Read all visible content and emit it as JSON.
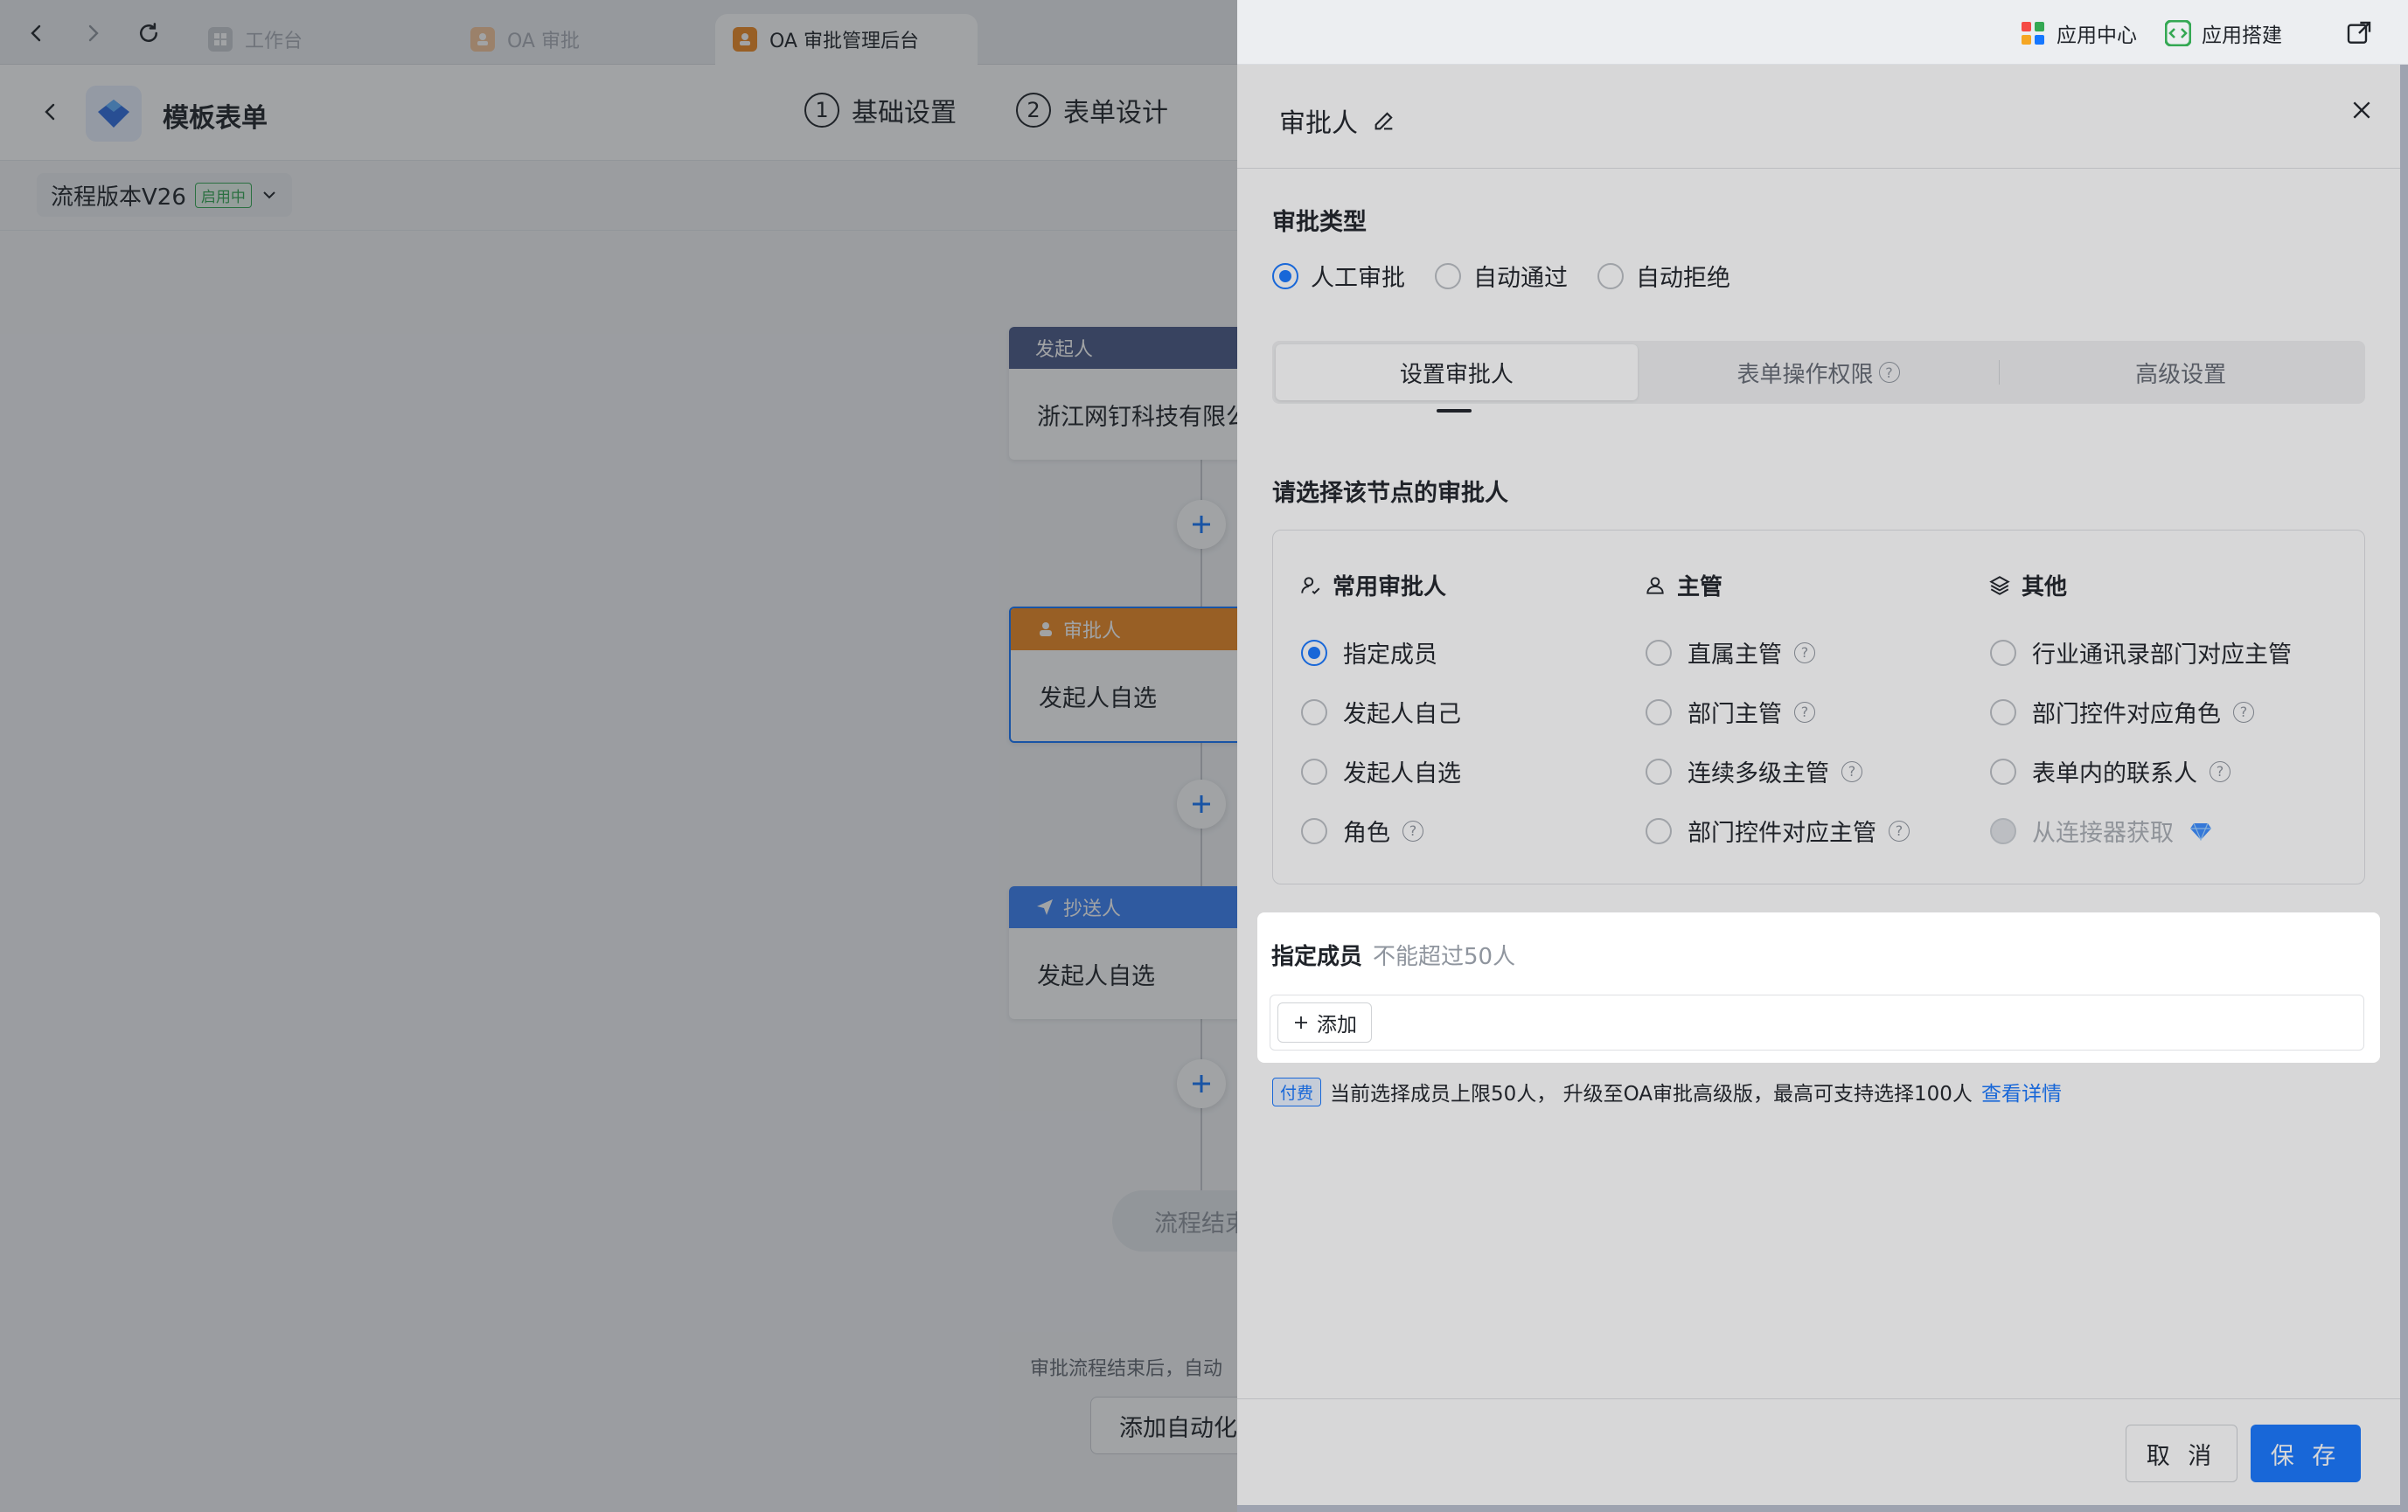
{
  "browser": {
    "tabs": [
      {
        "label": "工作台"
      },
      {
        "label": "OA 审批"
      },
      {
        "label": "OA 审批管理后台"
      }
    ],
    "app_center_label": "应用中心",
    "app_builder_label": "应用搭建"
  },
  "app": {
    "title": "模板表单",
    "steps": [
      {
        "num": "1",
        "label": "基础设置"
      },
      {
        "num": "2",
        "label": "表单设计"
      }
    ],
    "version": {
      "label": "流程版本V26",
      "status": "启用中"
    },
    "flow": {
      "initiator": {
        "head": "发起人",
        "body": "浙江网钉科技有限公"
      },
      "approver": {
        "head": "审批人",
        "body": "发起人自选"
      },
      "cc": {
        "head": "抄送人",
        "body": "发起人自选"
      },
      "end_label": "流程结束",
      "note": "审批流程结束后，自动",
      "automation_button": "添加自动化"
    }
  },
  "drawer": {
    "title": "审批人",
    "approval_type": {
      "label": "审批类型",
      "options": [
        "人工审批",
        "自动通过",
        "自动拒绝"
      ],
      "selected": "人工审批"
    },
    "tabs": [
      {
        "label": "设置审批人",
        "active": true
      },
      {
        "label": "表单操作权限",
        "help": true
      },
      {
        "label": "高级设置"
      }
    ],
    "choose_label": "请选择该节点的审批人",
    "columns": [
      {
        "title": "常用审批人",
        "options": [
          {
            "label": "指定成员",
            "selected": true
          },
          {
            "label": "发起人自己"
          },
          {
            "label": "发起人自选"
          },
          {
            "label": "角色",
            "help": true
          }
        ]
      },
      {
        "title": "主管",
        "options": [
          {
            "label": "直属主管",
            "help": true
          },
          {
            "label": "部门主管",
            "help": true
          },
          {
            "label": "连续多级主管",
            "help": true
          },
          {
            "label": "部门控件对应主管",
            "help": true
          }
        ]
      },
      {
        "title": "其他",
        "options": [
          {
            "label": "行业通讯录部门对应主管"
          },
          {
            "label": "部门控件对应角色",
            "help": true
          },
          {
            "label": "表单内的联系人",
            "help": true
          },
          {
            "label": "从连接器获取",
            "disabled": true
          }
        ]
      }
    ],
    "member": {
      "label": "指定成员",
      "hint": "不能超过50人",
      "add_label": "添加"
    },
    "pay": {
      "badge": "付费",
      "text": "当前选择成员上限50人， 升级至OA审批高级版，最高可支持选择100人",
      "link": "查看详情"
    },
    "cancel_label": "取 消",
    "save_label": "保 存"
  },
  "colors": {
    "primary": "#1677ff",
    "approver_head": "#f08a24",
    "initiator_head": "#4a5a88",
    "cc_head": "#3b82f6"
  }
}
